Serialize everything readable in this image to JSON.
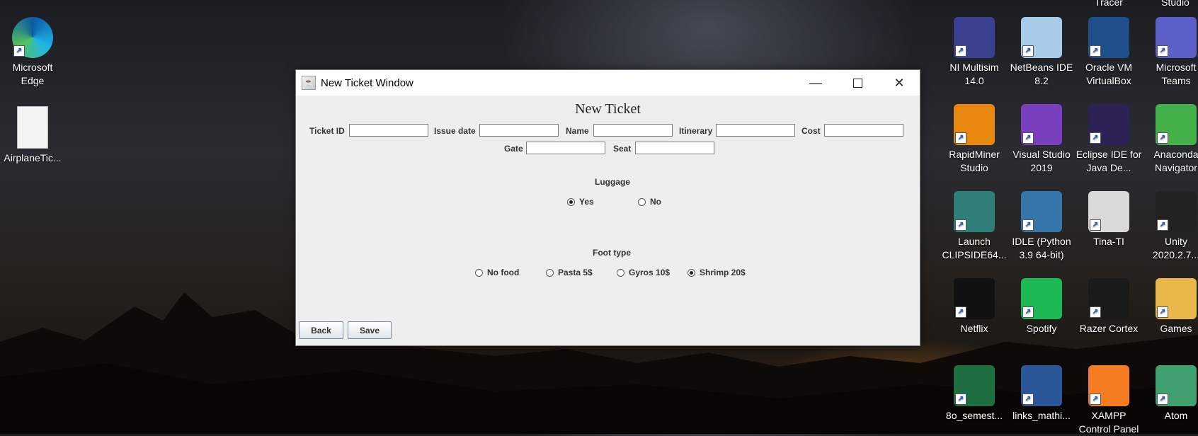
{
  "desktop": {
    "left_icons": [
      {
        "label": "Microsoft\nEdge",
        "icon": "edge-icon",
        "color": "#1f8fd6"
      },
      {
        "label": "AirplaneTic...",
        "icon": "document-icon",
        "color": "#f2f2f2"
      }
    ],
    "right_icons": [
      {
        "label": "NI Multisim 14.0",
        "icon": "multisim-icon",
        "color": "#3b3f8f"
      },
      {
        "label": "NetBeans IDE 8.2",
        "icon": "netbeans-icon",
        "color": "#a7cbe8"
      },
      {
        "label": "Oracle VM VirtualBox",
        "icon": "virtualbox-icon",
        "color": "#1e4f8a"
      },
      {
        "label": "Microsoft Teams",
        "icon": "teams-icon",
        "color": "#5b5fc7"
      },
      {
        "label": "RapidMiner Studio",
        "icon": "rapidminer-icon",
        "color": "#e8880f"
      },
      {
        "label": "Visual Studio 2019",
        "icon": "visual-studio-icon",
        "color": "#7a3fbf"
      },
      {
        "label": "Eclipse IDE for Java De...",
        "icon": "eclipse-icon",
        "color": "#2c2255"
      },
      {
        "label": "Anaconda Navigator",
        "icon": "anaconda-icon",
        "color": "#43b049"
      },
      {
        "label": "Launch CLIPSIDE64...",
        "icon": "clips-icon",
        "color": "#2f7e7a"
      },
      {
        "label": "IDLE (Python 3.9 64-bit)",
        "icon": "python-idle-icon",
        "color": "#3776ab"
      },
      {
        "label": "Tina-TI",
        "icon": "tina-ti-icon",
        "color": "#d9d9d9"
      },
      {
        "label": "Unity 2020.2.7...",
        "icon": "unity-icon",
        "color": "#222222"
      },
      {
        "label": "Netflix",
        "icon": "netflix-icon",
        "color": "#111111"
      },
      {
        "label": "Spotify",
        "icon": "spotify-icon",
        "color": "#1db954"
      },
      {
        "label": "Razer Cortex",
        "icon": "razer-cortex-icon",
        "color": "#1a1a1a"
      },
      {
        "label": "Games",
        "icon": "folder-icon",
        "color": "#e8b84a"
      },
      {
        "label": "8o_semest...",
        "icon": "excel-icon",
        "color": "#1d6f42"
      },
      {
        "label": "links_mathi...",
        "icon": "word-icon",
        "color": "#2b579a"
      },
      {
        "label": "XAMPP Control Panel",
        "icon": "xampp-icon",
        "color": "#f57c20"
      },
      {
        "label": "Atom",
        "icon": "atom-icon",
        "color": "#40a070"
      }
    ],
    "top_partial": [
      "Tracer",
      "Studio"
    ]
  },
  "window": {
    "title": "New Ticket Window",
    "heading": "New Ticket",
    "fields": {
      "ticket_id": {
        "label": "Ticket ID",
        "value": ""
      },
      "issue_date": {
        "label": "Issue date",
        "value": ""
      },
      "name": {
        "label": "Name",
        "value": ""
      },
      "itinerary": {
        "label": "Itinerary",
        "value": ""
      },
      "cost": {
        "label": "Cost",
        "value": ""
      },
      "gate": {
        "label": "Gate",
        "value": ""
      },
      "seat": {
        "label": "Seat",
        "value": ""
      }
    },
    "luggage": {
      "label": "Luggage",
      "options": [
        {
          "label": "Yes",
          "selected": true
        },
        {
          "label": "No",
          "selected": false
        }
      ]
    },
    "food": {
      "label": "Foot type",
      "options": [
        {
          "label": "No food",
          "selected": false
        },
        {
          "label": "Pasta 5$",
          "selected": false
        },
        {
          "label": "Gyros 10$",
          "selected": false
        },
        {
          "label": "Shrimp 20$",
          "selected": true
        }
      ]
    },
    "buttons": {
      "back": "Back",
      "save": "Save"
    }
  }
}
